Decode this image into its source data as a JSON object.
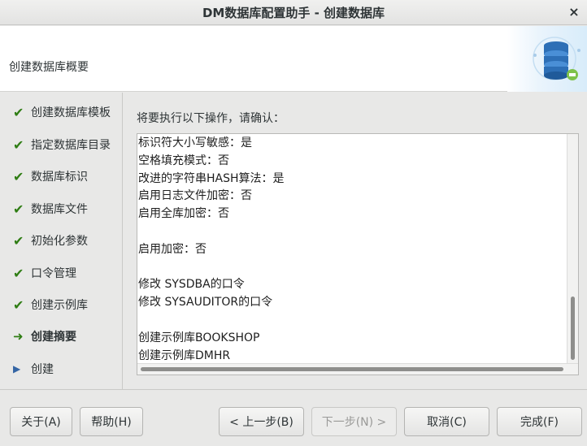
{
  "window": {
    "title": "DM数据库配置助手 - 创建数据库",
    "close_label": "×"
  },
  "header": {
    "title": "创建数据库概要",
    "logo_icon": "database-settings-icon"
  },
  "sidebar": {
    "steps": [
      {
        "label": "创建数据库模板",
        "status": "done"
      },
      {
        "label": "指定数据库目录",
        "status": "done"
      },
      {
        "label": "数据库标识",
        "status": "done"
      },
      {
        "label": "数据库文件",
        "status": "done"
      },
      {
        "label": "初始化参数",
        "status": "done"
      },
      {
        "label": "口令管理",
        "status": "done"
      },
      {
        "label": "创建示例库",
        "status": "done"
      },
      {
        "label": "创建摘要",
        "status": "current"
      },
      {
        "label": "创建",
        "status": "pending"
      }
    ],
    "marks": {
      "done": "✔",
      "current": "➜",
      "pending": "▶"
    }
  },
  "main": {
    "confirm_label": "将要执行以下操作，请确认：",
    "lines": [
      "标识符大小写敏感：是",
      "空格填充模式：否",
      "改进的字符串HASH算法：是",
      "启用日志文件加密：否",
      "启用全库加密：否",
      "",
      "启用加密：否",
      "",
      "修改 SYSDBA的口令",
      "修改 SYSAUDITOR的口令",
      "",
      "创建示例库BOOKSHOP",
      "创建示例库DMHR"
    ]
  },
  "footer": {
    "about_label": "关于(A)",
    "help_label": "帮助(H)",
    "prev_label": "< 上一步(B)",
    "next_label": "下一步(N) >",
    "cancel_label": "取消(C)",
    "finish_label": "完成(F)"
  },
  "colors": {
    "check": "#2f7d14",
    "pending_triangle": "#3465a4",
    "background": "#e8e8e7"
  }
}
